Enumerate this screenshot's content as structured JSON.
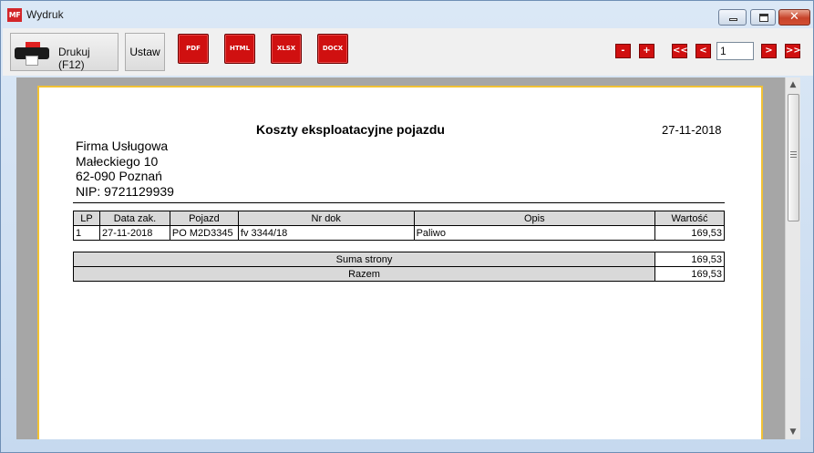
{
  "window": {
    "title": "Wydruk",
    "logo_text": "MF"
  },
  "toolbar": {
    "print_label": "Drukuj (F12)",
    "setup_label": "Ustaw",
    "exports": [
      "PDF",
      "HTML",
      "XLSX",
      "DOCX"
    ],
    "zoom_out": "-",
    "zoom_in": "+",
    "first": "<<",
    "prev": "<",
    "page": "1",
    "next": ">",
    "last": ">>"
  },
  "document": {
    "title": "Koszty eksploatacyjne pojazdu",
    "date": "27-11-2018",
    "company": [
      "Firma Usługowa",
      "Małeckiego 10",
      "62-090 Poznań",
      "NIP: 9721129939"
    ],
    "columns": [
      "LP",
      "Data zak.",
      "Pojazd",
      "Nr dok",
      "Opis",
      "Wartość"
    ],
    "rows": [
      [
        "1",
        "27-11-2018",
        "PO M2D3345",
        "fv 3344/18",
        "Paliwo",
        "169,53"
      ]
    ],
    "summary": [
      {
        "label": "Suma strony",
        "value": "169,53"
      },
      {
        "label": "Razem",
        "value": "169,53"
      }
    ]
  },
  "colors": {
    "accent": "#d01010",
    "page_border": "#f2c234"
  }
}
